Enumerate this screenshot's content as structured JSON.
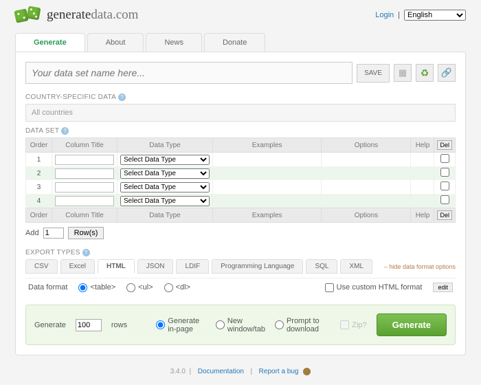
{
  "header": {
    "brand_bold": "generate",
    "brand_light": "data.com",
    "login": "Login",
    "sep": "|",
    "lang_selected": "English"
  },
  "nav": {
    "tabs": [
      "Generate",
      "About",
      "News",
      "Donate"
    ],
    "active": 0
  },
  "dataset_name": {
    "placeholder": "Your data set name here...",
    "save": "SAVE"
  },
  "sections": {
    "country": "COUNTRY-SPECIFIC DATA",
    "country_value": "All countries",
    "dataset": "DATA SET",
    "export": "EXPORT TYPES"
  },
  "grid": {
    "headers": [
      "Order",
      "Column Title",
      "Data Type",
      "Examples",
      "Options",
      "Help",
      "Del"
    ],
    "dtype_placeholder": "Select Data Type",
    "rows": [
      1,
      2,
      3,
      4
    ],
    "add_label": "Add",
    "add_count": "1",
    "add_btn": "Row(s)",
    "del_btn": "Del"
  },
  "export": {
    "tabs": [
      "CSV",
      "Excel",
      "HTML",
      "JSON",
      "LDIF",
      "Programming Language",
      "SQL",
      "XML"
    ],
    "active": 2,
    "hide": "hide data format options",
    "data_format_label": "Data format",
    "fmt_opts": [
      "<table>",
      "<ul>",
      "<dl>"
    ],
    "use_custom": "Use custom HTML format",
    "edit": "edit"
  },
  "generate": {
    "label": "Generate",
    "count": "100",
    "rows": "rows",
    "opts": [
      "Generate in-page",
      "New window/tab",
      "Prompt to download"
    ],
    "zip": "Zip?",
    "btn": "Generate"
  },
  "footer": {
    "ver": "3.4.0",
    "doc": "Documentation",
    "bug": "Report a bug"
  }
}
